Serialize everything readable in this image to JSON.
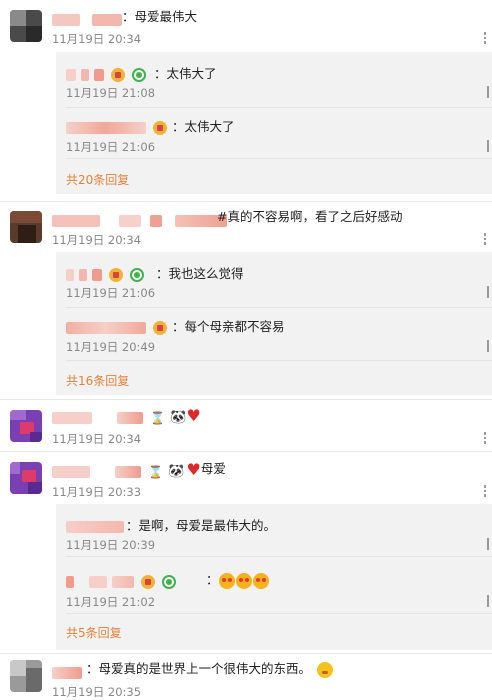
{
  "comments": [
    {
      "text": "：母爱最伟大",
      "time": "11月19日 20:34",
      "replies": [
        {
          "text": "：太伟大了",
          "time": "11月19日 21:08"
        },
        {
          "text": "：太伟大了",
          "time": "11月19日 21:06"
        }
      ],
      "more": "共20条回复"
    },
    {
      "text": "#真的不容易啊，看了之后好感动",
      "time": "11月19日 20:34",
      "replies": [
        {
          "text": "：我也这么觉得",
          "time": "11月19日 21:06"
        },
        {
          "text": "：每个母亲都不容易",
          "time": "11月19日 20:49"
        }
      ],
      "more": "共16条回复"
    },
    {
      "text": "：",
      "time": "11月19日 20:34"
    },
    {
      "text": "：",
      "suffix": "母爱",
      "time": "11月19日 20:33",
      "replies": [
        {
          "text": "：是啊，母爱是最伟大的。",
          "time": "11月19日 20:39"
        },
        {
          "text": "：",
          "time": "11月19日 21:02"
        }
      ],
      "more": "共5条回复"
    },
    {
      "text": "：母爱真的是世界上一个很伟大的东西。",
      "time": "11月19日 20:35"
    }
  ],
  "icons": {
    "more": "more-options-icon",
    "vip": "vip-badge-icon",
    "verified": "verified-badge-icon",
    "heart": "heart-icon",
    "panda": "panda-icon",
    "hourglass": "hourglass-icon",
    "kiss": "kiss-face-icon",
    "flushed": "flushed-face-icon"
  },
  "colors": {
    "accent": "#e8823a",
    "timestamp": "#888888",
    "replyBackground": "#f2f2f2"
  }
}
